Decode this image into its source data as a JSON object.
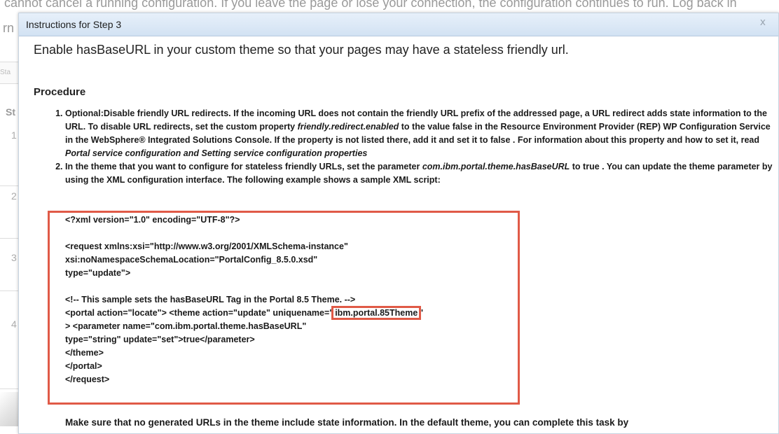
{
  "background": {
    "top_text": "cannot cancel a running configuration. If you leave the page or lose your connection, the configuration continues to run. Log back in",
    "left_fragment": "rn",
    "tab_fragment": "Sta",
    "steps_fragment": "St",
    "row_numbers": [
      "1",
      "2",
      "3",
      "4"
    ]
  },
  "dialog": {
    "title": "Instructions for Step 3",
    "close_glyph": "x",
    "intro": "Enable hasBaseURL in your custom theme so that your pages may have a stateless friendly url.",
    "procedure_heading": "Procedure",
    "step1": {
      "part1": "Optional:Disable friendly URL redirects. If the incoming URL does not contain the friendly URL prefix of the addressed page, a URL redirect adds state information to the URL. To disable URL redirects, set the custom property ",
      "prop": "friendly.redirect.enabled",
      "part2": " to the value false in the Resource Environment Provider (REP) WP Configuration Service in the WebSphere® Integrated Solutions Console. If the property is not listed there, add it and set it to false . For information about this property and how to set it, read ",
      "ref": "Portal service configuration and Setting service configuration properties"
    },
    "step2": {
      "part1": "In the theme that you want to configure for stateless friendly URLs, set the parameter ",
      "param": "com.ibm.portal.theme.hasBaseURL",
      "part2": " to true . You can update the theme parameter by using the XML configuration interface. The following example shows a sample XML script:"
    },
    "code": {
      "line1": "<?xml version=\"1.0\" encoding=\"UTF-8\"?>",
      "line2": "",
      "line3": "<request xmlns:xsi=\"http://www.w3.org/2001/XMLSchema-instance\"",
      "line4": "xsi:noNamespaceSchemaLocation=\"PortalConfig_8.5.0.xsd\"",
      "line5": "type=\"update\">",
      "line6": "",
      "line7": "<!-- This sample sets the hasBaseURL Tag in the Portal 8.5 Theme. -->",
      "line8_pre": "<portal action=\"locate\"> <theme action=\"update\" uniquename=\"",
      "line8_hl": "ibm.portal.85Theme",
      "line8_post": "\"",
      "line9": "> <parameter name=\"com.ibm.portal.theme.hasBaseURL\"",
      "line10": "type=\"string\" update=\"set\">true</parameter>",
      "line11": "</theme>",
      "line12": "</portal>",
      "line13": "</request>"
    },
    "bottom_text": "Make sure that no generated URLs in the theme include state information. In the default theme, you can complete this task by"
  },
  "colors": {
    "highlight_border": "#e05a47",
    "titlebar": "#d9e6f5"
  }
}
